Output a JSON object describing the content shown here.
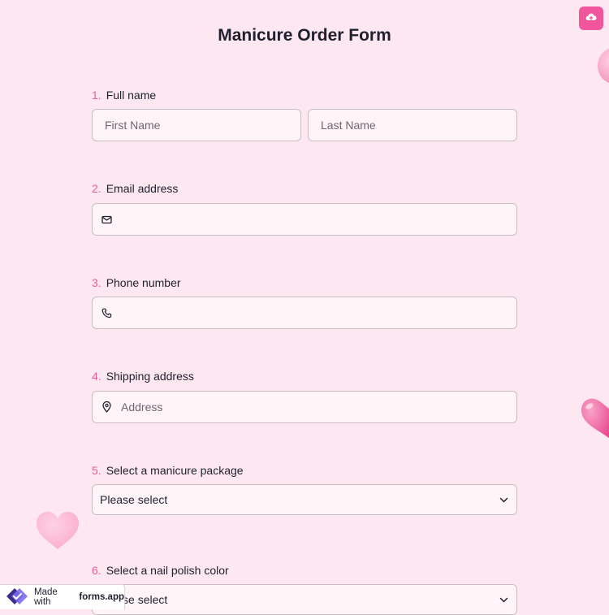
{
  "header": {
    "title": "Manicure Order Form",
    "save_icon": "cloud-upload-icon",
    "accent_color": "#f0569b"
  },
  "questions": [
    {
      "number": "1.",
      "label": "Full name",
      "fields": [
        {
          "placeholder": "First Name"
        },
        {
          "placeholder": "Last Name"
        }
      ]
    },
    {
      "number": "2.",
      "label": "Email address",
      "icon": "mail-icon"
    },
    {
      "number": "3.",
      "label": "Phone number",
      "icon": "phone-icon"
    },
    {
      "number": "4.",
      "label": "Shipping address",
      "icon": "map-pin-icon",
      "placeholder": "Address"
    },
    {
      "number": "5.",
      "label": "Select a manicure package",
      "selected": "Please select"
    },
    {
      "number": "6.",
      "label": "Select a nail polish color",
      "selected": "Please select"
    }
  ],
  "badge": {
    "prefix": "Made with",
    "brand": "forms.app"
  }
}
